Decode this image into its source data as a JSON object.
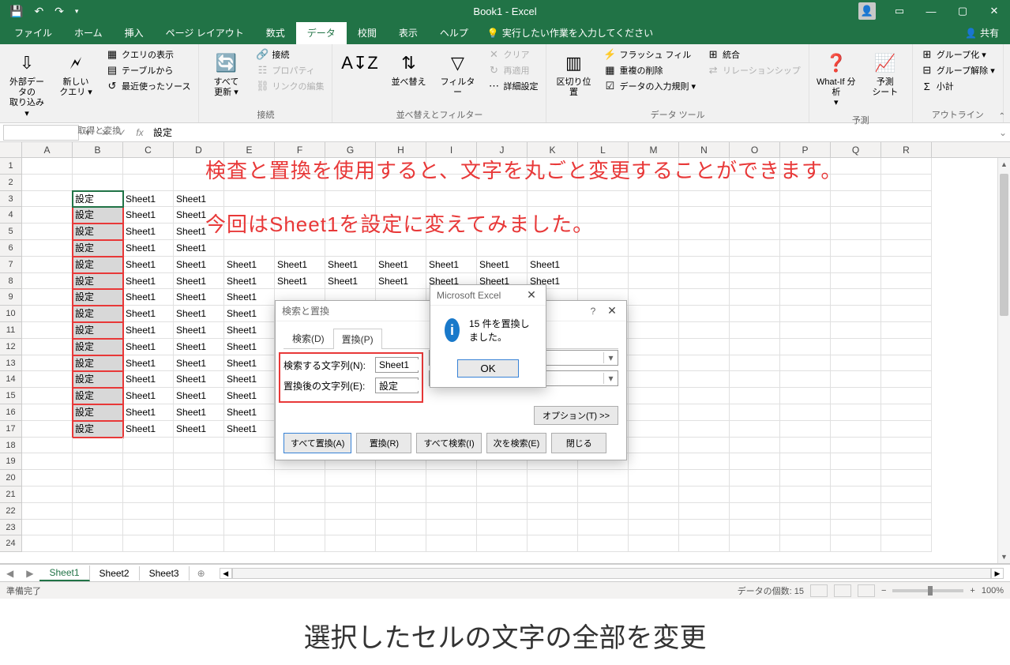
{
  "titlebar": {
    "title": "Book1  -  Excel"
  },
  "tabs": {
    "items": [
      "ファイル",
      "ホーム",
      "挿入",
      "ページ レイアウト",
      "数式",
      "データ",
      "校閲",
      "表示",
      "ヘルプ"
    ],
    "active": 5,
    "tellme": "実行したい作業を入力してください",
    "share": "共有"
  },
  "ribbon": {
    "groups": [
      {
        "label": "取得と変換",
        "big": [
          {
            "label": "外部データの\n取り込み ▾",
            "icon": "⇩"
          },
          {
            "label": "新しい\nクエリ ▾",
            "icon": "🗲"
          }
        ],
        "small": [
          {
            "label": "クエリの表示",
            "icon": "▦"
          },
          {
            "label": "テーブルから",
            "icon": "▤"
          },
          {
            "label": "最近使ったソース",
            "icon": "↺"
          }
        ]
      },
      {
        "label": "接続",
        "big": [
          {
            "label": "すべて\n更新 ▾",
            "icon": "🔄"
          }
        ],
        "small": [
          {
            "label": "接続",
            "icon": "🔗"
          },
          {
            "label": "プロパティ",
            "icon": "☷",
            "disabled": true
          },
          {
            "label": "リンクの編集",
            "icon": "⛓",
            "disabled": true
          }
        ]
      },
      {
        "label": "並べ替えとフィルター",
        "big": [
          {
            "label": "",
            "icon": "A↧Z"
          },
          {
            "label": "並べ替え",
            "icon": "⇅"
          },
          {
            "label": "フィルター",
            "icon": "▽"
          }
        ],
        "small": [
          {
            "label": "クリア",
            "icon": "✕",
            "disabled": true
          },
          {
            "label": "再適用",
            "icon": "↻",
            "disabled": true
          },
          {
            "label": "詳細設定",
            "icon": "⋯"
          }
        ]
      },
      {
        "label": "データ ツール",
        "big": [
          {
            "label": "区切り位置",
            "icon": "▥"
          }
        ],
        "small": [
          {
            "label": "フラッシュ フィル",
            "icon": "⚡"
          },
          {
            "label": "重複の削除",
            "icon": "▦"
          },
          {
            "label": "データの入力規則 ▾",
            "icon": "☑"
          }
        ],
        "extra": [
          {
            "label": "統合",
            "icon": "⊞"
          },
          {
            "label": "リレーションシップ",
            "icon": "⇄",
            "disabled": true
          }
        ]
      },
      {
        "label": "予測",
        "big": [
          {
            "label": "What-If 分析\n▾",
            "icon": "❓"
          },
          {
            "label": "予測\nシート",
            "icon": "📈"
          }
        ]
      },
      {
        "label": "アウトライン",
        "small": [
          {
            "label": "グループ化  ▾",
            "icon": "⊞"
          },
          {
            "label": "グループ解除  ▾",
            "icon": "⊟"
          },
          {
            "label": "小計",
            "icon": "Σ"
          }
        ]
      }
    ]
  },
  "formula_bar": {
    "name_box": "",
    "value": "設定"
  },
  "grid": {
    "columns": [
      "A",
      "B",
      "C",
      "D",
      "E",
      "F",
      "G",
      "H",
      "I",
      "J",
      "K",
      "L",
      "M",
      "N",
      "O",
      "P",
      "Q",
      "R"
    ],
    "row_count": 24,
    "settei": "設定",
    "sheet1": "Sheet1"
  },
  "annotations": {
    "line1": "検査と置換を使用すると、文字を丸ごと変更することができます。",
    "line2": "今回はSheet1を設定に変えてみました。",
    "bottom": "選択したセルの文字の全部を変更"
  },
  "find_replace": {
    "title": "検索と置換",
    "tab_find": "検索(D)",
    "tab_replace": "置換(P)",
    "find_label": "検索する文字列(N):",
    "replace_label": "置換後の文字列(E):",
    "find_value": "Sheet1",
    "replace_value": "設定",
    "options_btn": "オプション(T) >>",
    "buttons": [
      "すべて置換(A)",
      "置換(R)",
      "すべて検索(I)",
      "次を検索(E)",
      "閉じる"
    ]
  },
  "msgbox": {
    "title": "Microsoft Excel",
    "message": "15 件を置換しました。",
    "ok": "OK"
  },
  "sheet_tabs": {
    "items": [
      "Sheet1",
      "Sheet2",
      "Sheet3"
    ],
    "active": 0
  },
  "status": {
    "ready": "準備完了",
    "count": "データの個数: 15",
    "zoom": "100%"
  }
}
